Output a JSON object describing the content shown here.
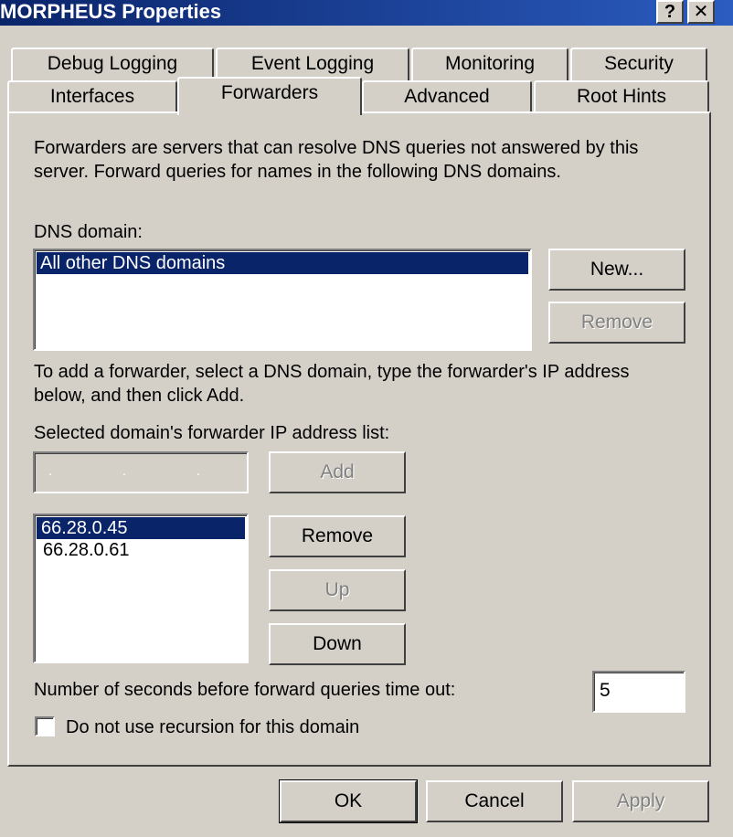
{
  "window": {
    "title": "MORPHEUS Properties",
    "help_glyph": "?",
    "close_glyph": "✕"
  },
  "tabs": {
    "row1": [
      "Debug Logging",
      "Event Logging",
      "Monitoring",
      "Security"
    ],
    "row2": [
      "Interfaces",
      "Forwarders",
      "Advanced",
      "Root Hints"
    ],
    "active": "Forwarders"
  },
  "forwarders": {
    "description_line1": "Forwarders are servers that can resolve DNS queries not answered by this",
    "description_line2": "server. Forward queries for names in the following DNS domains.",
    "dns_domain_label": "DNS domain:",
    "dns_domains": [
      "All other DNS domains"
    ],
    "new_button": "New...",
    "remove_domain_button": "Remove",
    "instruction_line1": "To add a forwarder, select a DNS domain, type the forwarder's IP address",
    "instruction_line2": "below, and then click Add.",
    "ip_list_label": "Selected domain's forwarder IP address list:",
    "ip_input_value": ". . .",
    "add_button": "Add",
    "ip_addresses": [
      "66.28.0.45",
      "66.28.0.61"
    ],
    "remove_ip_button": "Remove",
    "up_button": "Up",
    "down_button": "Down",
    "timeout_label": "Number of seconds before forward queries time out:",
    "timeout_value": "5",
    "recursion_label": "Do not use recursion for this domain",
    "recursion_checked": false
  },
  "footer": {
    "ok_button": "OK",
    "cancel_button": "Cancel",
    "apply_button": "Apply"
  }
}
